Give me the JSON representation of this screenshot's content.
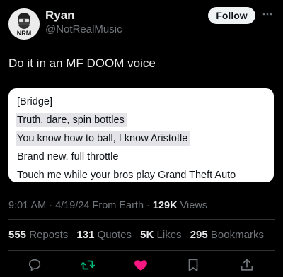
{
  "author": {
    "name": "Ryan",
    "handle": "@NotRealMusic",
    "avatar_initials": "NRM"
  },
  "header": {
    "follow_label": "Follow",
    "more_icon": "more-horizontal-icon"
  },
  "tweet": {
    "text": "Do it in an MF DOOM voice"
  },
  "lyrics": {
    "lines": [
      {
        "text": "[Bridge]",
        "highlighted": false
      },
      {
        "text": "Truth, dare, spin bottles",
        "highlighted": true
      },
      {
        "text": "You know how to ball, I know Aristotle",
        "highlighted": true
      },
      {
        "text": "Brand new, full throttle",
        "highlighted": false
      },
      {
        "text": "Touch me while your bros play Grand Theft Auto",
        "highlighted": false
      }
    ]
  },
  "meta": {
    "time": "9:01 AM",
    "date": "4/19/24",
    "source": "From Earth",
    "views_count": "129K",
    "views_label": "Views"
  },
  "stats": {
    "reposts_count": "555",
    "reposts_label": "Reposts",
    "quotes_count": "131",
    "quotes_label": "Quotes",
    "likes_count": "5K",
    "likes_label": "Likes",
    "bookmarks_count": "295",
    "bookmarks_label": "Bookmarks"
  },
  "actions": [
    {
      "icon": "reply-icon",
      "color": "#71767b"
    },
    {
      "icon": "retweet-icon",
      "color": "#00ba7c"
    },
    {
      "icon": "heart-icon",
      "color": "#f91880"
    },
    {
      "icon": "bookmark-icon",
      "color": "#71767b"
    },
    {
      "icon": "share-icon",
      "color": "#71767b"
    }
  ]
}
